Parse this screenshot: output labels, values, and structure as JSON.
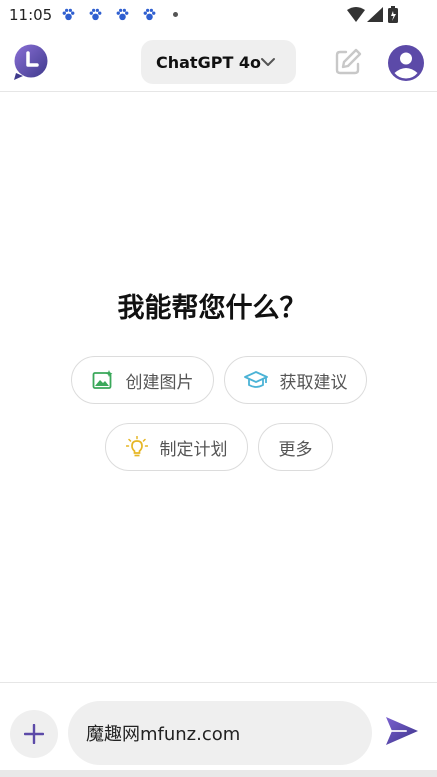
{
  "status_bar": {
    "time": "11:05",
    "notification_icons": [
      "paw-icon",
      "paw-icon",
      "paw-icon",
      "paw-icon"
    ]
  },
  "header": {
    "model_label": "ChatGPT 4o",
    "history_icon": "clock-icon",
    "new_chat_icon": "edit-icon",
    "avatar_icon": "user-icon"
  },
  "main": {
    "headline": "我能帮您什么？",
    "suggestions": [
      {
        "label": "创建图片",
        "icon": "image-icon",
        "color": "#3aa85a"
      },
      {
        "label": "获取建议",
        "icon": "graduation-cap-icon",
        "color": "#4bb3d6"
      },
      {
        "label": "制定计划",
        "icon": "lightbulb-icon",
        "color": "#e6b625"
      },
      {
        "label": "更多",
        "icon": ""
      }
    ]
  },
  "composer": {
    "input_value": "魔趣网mfunz.com",
    "add_icon": "plus-icon",
    "send_icon": "send-icon"
  },
  "colors": {
    "brand_purple": "#5c4aa8",
    "chip_border": "#dcdcdc",
    "pill_bg": "#efefef"
  }
}
